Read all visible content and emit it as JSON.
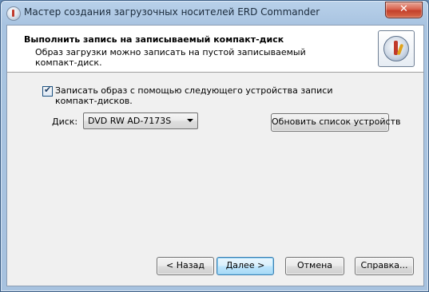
{
  "window": {
    "title": "Мастер создания загрузочных носителей ERD Commander",
    "close_label": "✕"
  },
  "header": {
    "title": "Выполнить запись на записываемый компакт-диск",
    "subtitle_line1": "Образ загрузки можно записать на пустой записываемый",
    "subtitle_line2": "компакт-диск.",
    "icon": "wizard-disc-icon"
  },
  "burn_option": {
    "checked": true,
    "label_line1": "Записать образ с помощью следующего устройства записи",
    "label_line2": "компакт-дисков."
  },
  "drive": {
    "label": "Диск:",
    "selected": "DVD RW AD-7173S",
    "refresh_label": "Обновить список устройств"
  },
  "buttons": {
    "back_label": "< Назад",
    "next_label": "Далее >",
    "cancel_label": "Отмена",
    "help_label": "Справка..."
  }
}
